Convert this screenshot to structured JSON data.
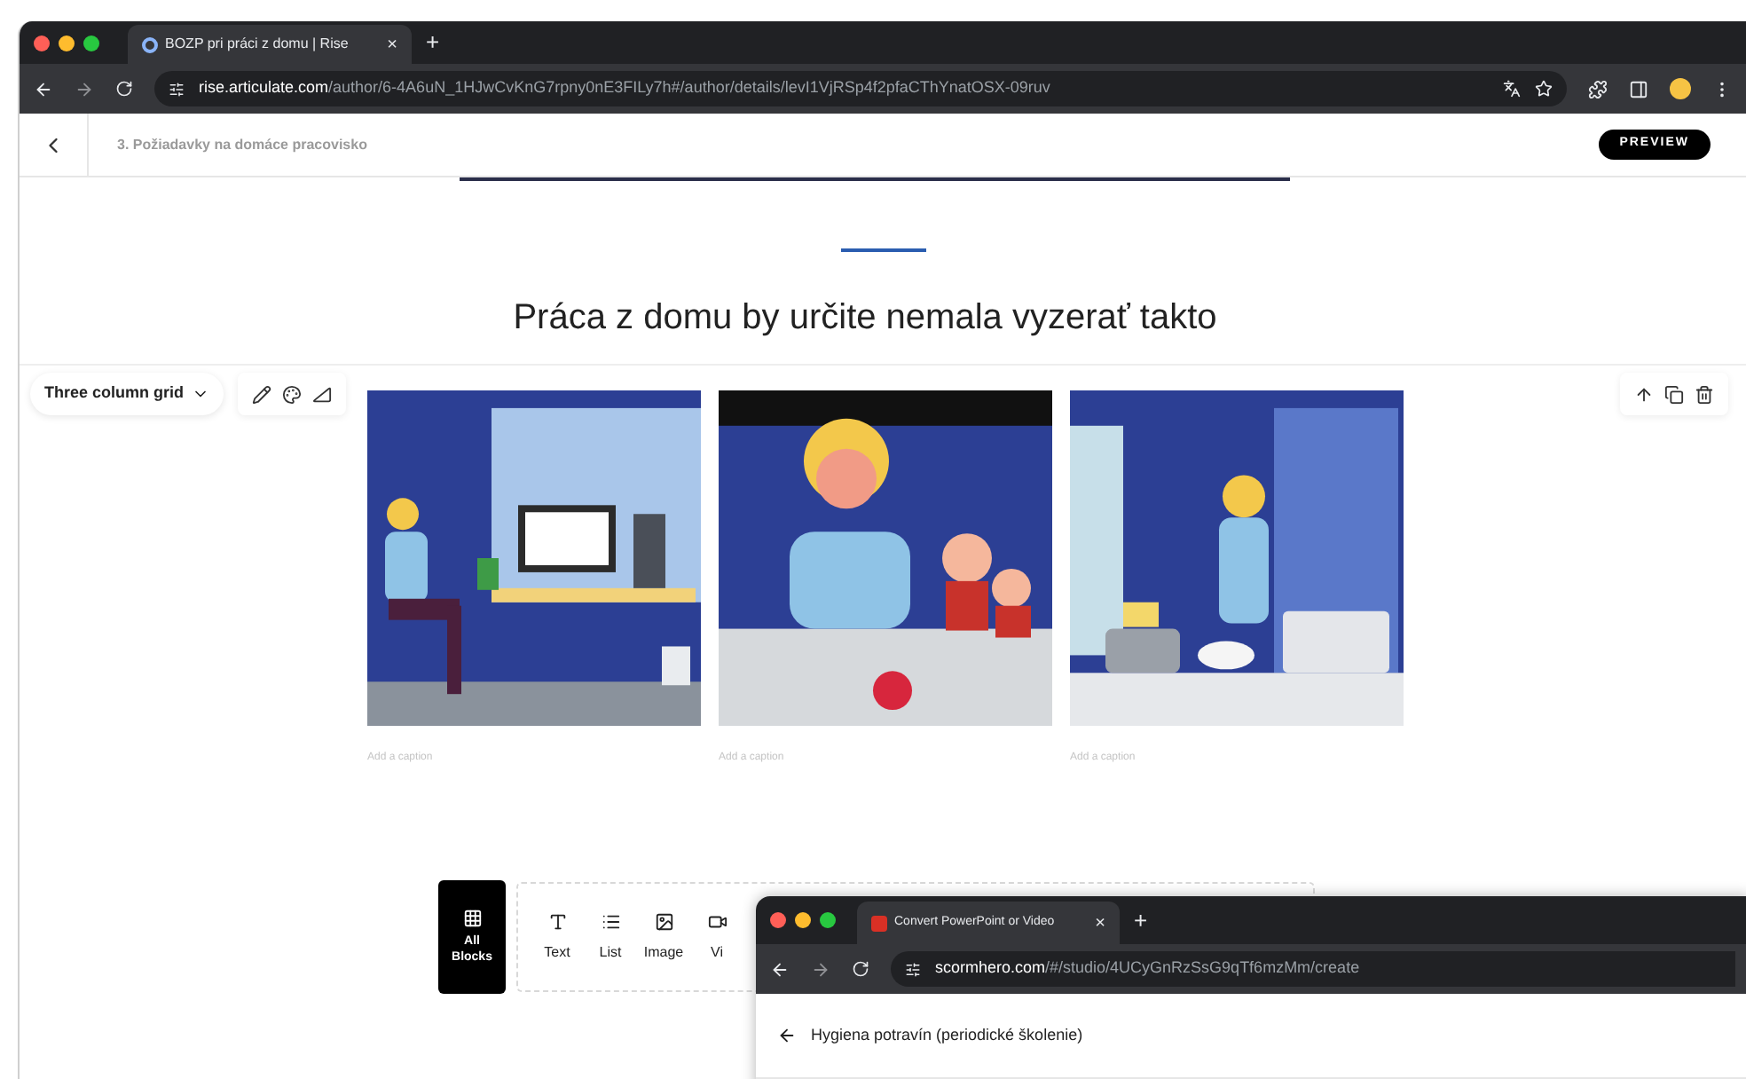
{
  "browser": {
    "tab_title": "BOZP pri práci z domu | Rise",
    "tab_close": "×",
    "new_tab": "+",
    "url_host": "rise.articulate.com",
    "url_path": "/author/6-4A6uN_1HJwCvKnG7rpny0nE3FILy7h#/author/details/levI1VjRSp4f2pfaCThYnatOSX-09ruv"
  },
  "header": {
    "lesson_title": "3. Požiadavky na domáce pracovisko",
    "preview_button": "PREVIEW"
  },
  "heading": "Práca z domu by určite nemala vyzerať takto",
  "block_style": {
    "label": "Three column grid"
  },
  "images": [
    {
      "kind": "picture",
      "caption_placeholder": "Add a caption"
    },
    {
      "kind": "picture",
      "caption_placeholder": "Add a caption"
    },
    {
      "kind": "picture",
      "caption_placeholder": "Add a caption"
    }
  ],
  "block_bar": {
    "all_blocks": "All Blocks",
    "items": [
      {
        "kind": "text",
        "label": "Text"
      },
      {
        "kind": "list",
        "label": "List"
      },
      {
        "label": "Image"
      },
      {
        "kind": "video",
        "label": "Vi"
      }
    ]
  },
  "overlay_window": {
    "tab_title": "Convert PowerPoint or Video",
    "tab_close": "×",
    "new_tab": "+",
    "url_host": "scormhero.com",
    "url_path": "/#/studio/4UCyGnRzSsG9qTf6mzMm/create",
    "back_title": "Hygiena potravín (periodické školenie)"
  }
}
